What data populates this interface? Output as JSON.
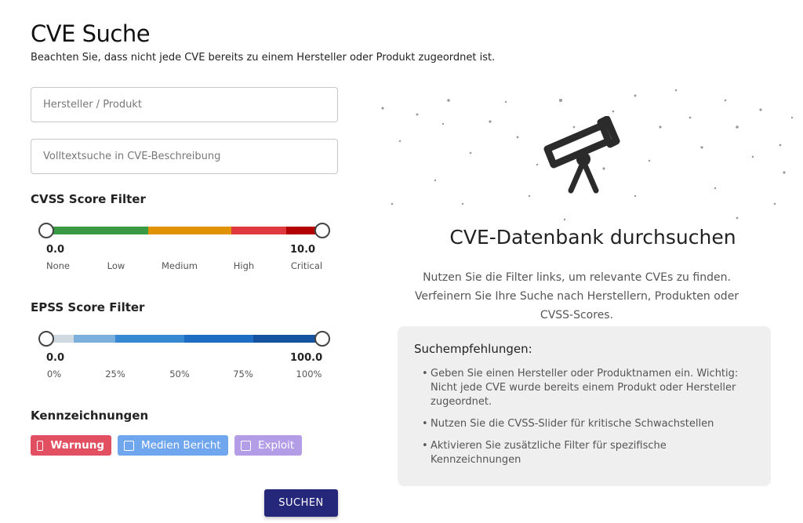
{
  "header": {
    "title": "CVE Suche",
    "subtitle": "Beachten Sie, dass nicht jede CVE bereits zu einem Hersteller oder Produkt zugeordnet ist."
  },
  "inputs": {
    "vendor_placeholder": "Hersteller / Produkt",
    "fulltext_placeholder": "Volltextsuche in CVE-Beschreibung"
  },
  "cvss": {
    "title": "CVSS Score Filter",
    "min_label": "0.0",
    "max_label": "10.0",
    "min": 0,
    "max": 10,
    "selected_min": 0,
    "selected_max": 10,
    "colors": [
      "#3a9a44",
      "#e09200",
      "#e0383f",
      "#b30000"
    ],
    "ticks": [
      "None",
      "Low",
      "Medium",
      "High",
      "Critical"
    ]
  },
  "epss": {
    "title": "EPSS Score Filter",
    "min_label": "0.0",
    "max_label": "100.0",
    "min": 0,
    "max": 100,
    "selected_min": 0,
    "selected_max": 100,
    "colors": [
      "#d1d9e0",
      "#7bb0dc",
      "#3889d4",
      "#1e6dc2",
      "#1552a0"
    ],
    "ticks": [
      "0%",
      "25%",
      "50%",
      "75%",
      "100%"
    ]
  },
  "flags": {
    "title": "Kennzeichnungen",
    "items": [
      {
        "label": "Warnung",
        "color": "#e14f60",
        "checked": false
      },
      {
        "label": "Medien Bericht",
        "color": "#6fa6ee",
        "checked": false
      },
      {
        "label": "Exploit",
        "color": "#b39de6",
        "checked": false
      }
    ]
  },
  "search_button": "SUCHEN",
  "hero": {
    "icon": "telescope-icon",
    "title": "CVE-Datenbank durchsuchen",
    "text": "Nutzen Sie die Filter links, um relevante CVEs zu finden. Verfeinern Sie Ihre Suche nach Herstellern, Produkten oder CVSS-Scores."
  },
  "suggestions": {
    "title": "Suchempfehlungen:",
    "items": [
      "Geben Sie einen Hersteller oder Produktnamen ein. Wichtig: Nicht jede CVE wurde bereits einem Produkt oder Hersteller zugeordnet.",
      "Nutzen Sie die CVSS-Slider für kritische Schwachstellen",
      "Aktivieren Sie zusätzliche Filter für spezifische Kennzeichnungen"
    ]
  }
}
